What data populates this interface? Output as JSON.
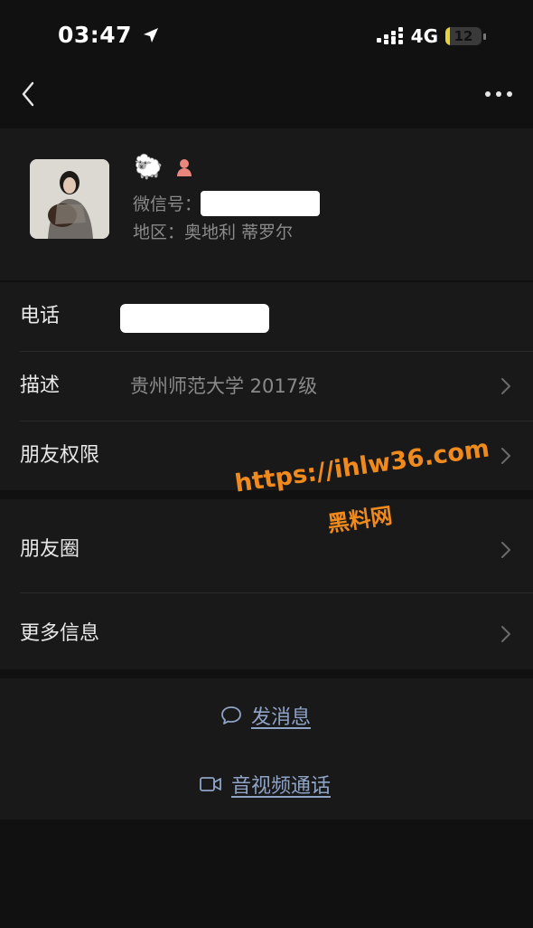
{
  "status_bar": {
    "time": "03:47",
    "network": "4G",
    "battery": "12",
    "battery_level": 0.12,
    "location_icon": "location-arrow-icon",
    "signal_icon": "signal-dots-icon"
  },
  "header": {
    "back_icon": "chevron-left-icon",
    "more_icon": "ellipsis-icon"
  },
  "profile": {
    "nickname": "🐑",
    "gender_icon": "female-person-icon",
    "wechat_id_label": "微信号：",
    "region": "地区：奥地利 蒂罗尔"
  },
  "rows": {
    "phone_label": "电话",
    "description_label": "描述",
    "description_value": "贵州师范大学 2017级",
    "permissions_label": "朋友权限",
    "moments_label": "朋友圈",
    "more_info_label": "更多信息"
  },
  "actions": {
    "message_label": "发消息",
    "call_label": "音视频通话"
  },
  "watermark": {
    "url": "https://ihlw36.com",
    "name": "黑料网"
  },
  "colors": {
    "background": "#111111",
    "section": "#191919",
    "link": "#8ea3c6",
    "watermark": "#f08a1c"
  }
}
